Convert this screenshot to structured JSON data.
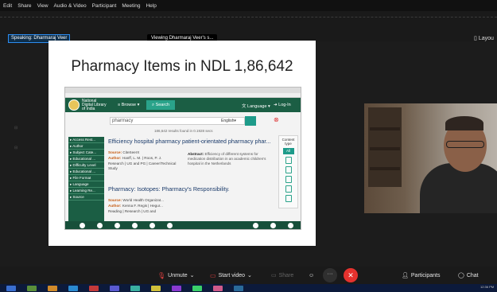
{
  "menu": [
    "Edit",
    "Share",
    "View",
    "Audio & Video",
    "Participant",
    "Meeting",
    "Help"
  ],
  "top": {
    "speaking": "Speaking: Dharmaraj Veer",
    "viewing": "Viewing Dharmaraj Veer's s...",
    "layout": "Layou"
  },
  "slide": {
    "title": "Pharmacy Items in NDL 1,86,642"
  },
  "ndl": {
    "name_line1": "National",
    "name_line2": "Digital Library",
    "name_line3": "of India",
    "browse": "Browse",
    "search_btn": "Search",
    "language": "Language",
    "login": "Log-In",
    "search_value": "pharmacy",
    "search_lang": "English",
    "results_count": "186,642 results found in 0.1928 secs",
    "facets": [
      "Access Rest...",
      "Author",
      "Subject Cate...",
      "Educational ...",
      "Difficulty Level",
      "Educational ...",
      "File Format",
      "Language",
      "Learning Re...",
      "Source"
    ],
    "content_type_label": "Content type",
    "content_type_all": "All",
    "result1": {
      "title": "Efficiency hospital pharmacy patient-orientated pharmacy phar...",
      "source_label": "Source:",
      "source": "CiteSeerX",
      "author_label": "Author:",
      "author": "Hanff, L. M. | Roos, P. J.",
      "tags": "Research | UG and PG | Career/Technical Study",
      "abstract_label": "Abstract:",
      "abstract": "Efficiency of different systems for medication distribution in an academic children's hospital in the Netherlands"
    },
    "result2": {
      "title": "Pharmacy: Isotopes: Pharmacy's Responsibility.",
      "source_label": "Source:",
      "source": "World Health Organizat...",
      "author_label": "Author:",
      "author": "Kenna F. Regis | Hegur...",
      "tags": "Reading | Research | UG and"
    }
  },
  "toolbar": {
    "unmute": "Unmute",
    "start_video": "Start video",
    "share": "Share",
    "participants": "Participants",
    "chat": "Chat"
  },
  "taskbar": {
    "time": "12:36 PM"
  },
  "colors": {
    "ndl_green": "#1b5e44",
    "accent_teal": "#1e9b8a",
    "end_red": "#e5322e",
    "speaking_border": "#2d8cf0"
  },
  "icons": [
    "unmute-icon",
    "video-off-icon",
    "share-icon",
    "reactions-icon",
    "more-icon",
    "end-call-icon",
    "participants-icon",
    "chat-icon",
    "layout-icon"
  ]
}
